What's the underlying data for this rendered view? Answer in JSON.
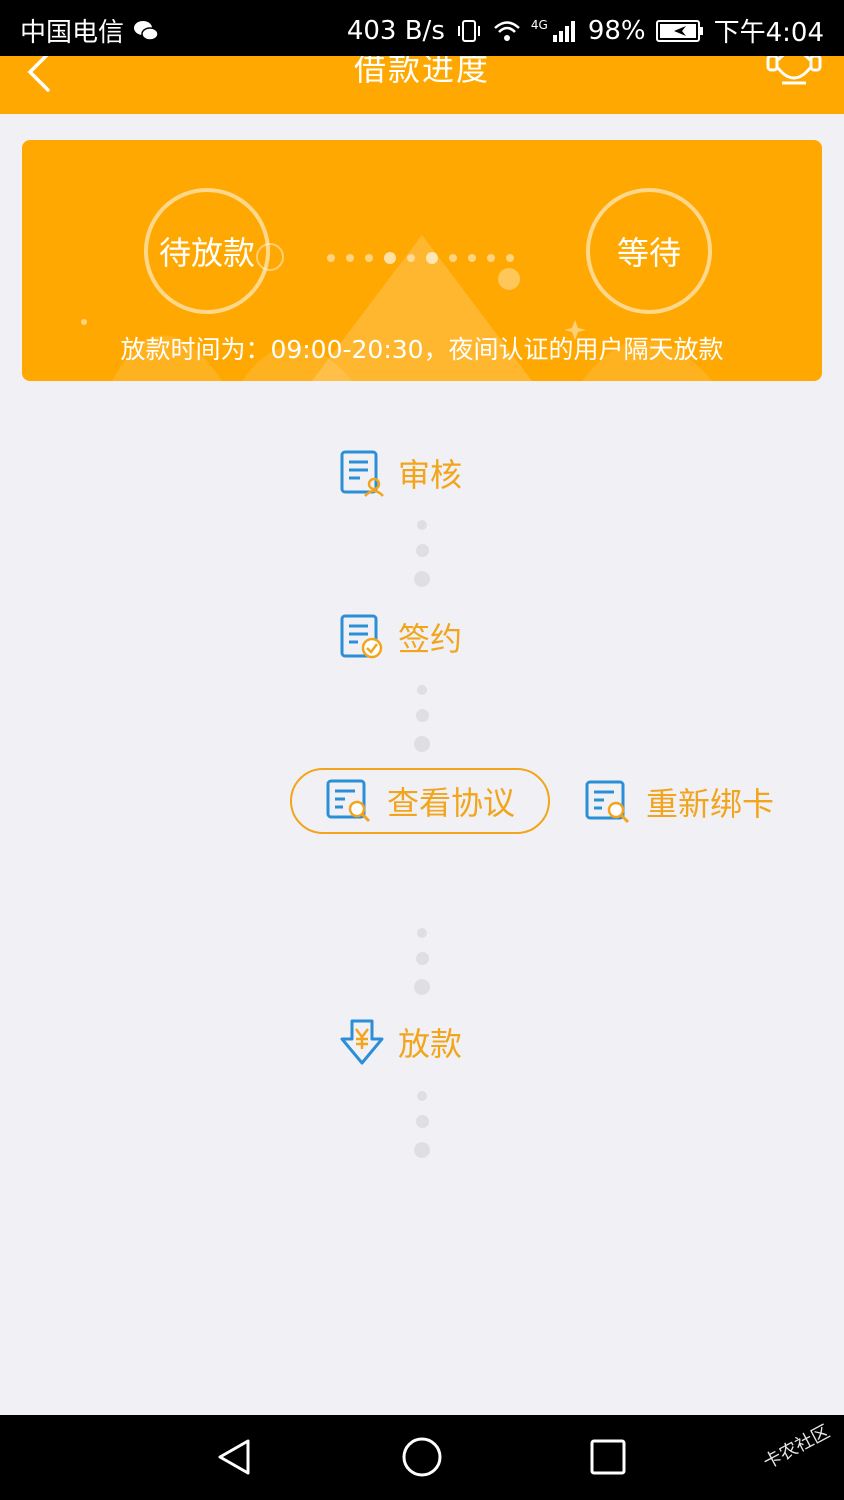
{
  "status_bar": {
    "carrier": "中国电信",
    "speed": "403 B/s",
    "network": "4G",
    "battery": "98%",
    "time": "下午4:04"
  },
  "header": {
    "title": "借款进度"
  },
  "banner": {
    "status_left": "待放款",
    "status_right": "等待",
    "note": "放款时间为：09:00-20:30，夜间认证的用户隔天放款"
  },
  "steps": {
    "audit": "审核",
    "sign": "签约",
    "loan": "放款"
  },
  "actions": {
    "view_protocol": "查看协议",
    "rebind_card": "重新绑卡"
  },
  "watermark": "卡农社区",
  "colors": {
    "accent": "#FFA802",
    "step_text": "#F2A51C",
    "icon_blue": "#2B8FD8",
    "background": "#f1f1f5"
  }
}
